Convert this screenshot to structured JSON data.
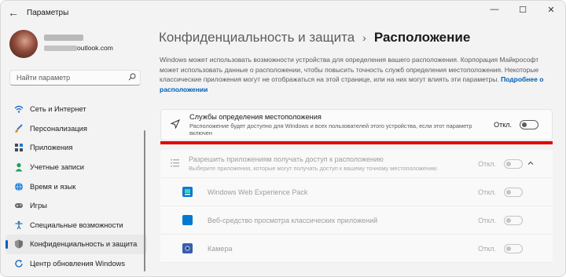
{
  "window": {
    "title": "Параметры",
    "back_icon": "back-arrow-icon",
    "controls": {
      "minimize": "—",
      "maximize": "☐",
      "close": "✕"
    }
  },
  "user": {
    "email_suffix": "outlook.com"
  },
  "search": {
    "placeholder": "Найти параметр",
    "icon": "search-icon"
  },
  "sidebar": {
    "items": [
      {
        "label": "Сеть и Интернет",
        "icon": "wifi-icon",
        "color": "#1a6fc4"
      },
      {
        "label": "Персонализация",
        "icon": "brush-icon",
        "color": "#e08a1e"
      },
      {
        "label": "Приложения",
        "icon": "apps-icon",
        "color": "#3f4a59"
      },
      {
        "label": "Учетные записи",
        "icon": "person-icon",
        "color": "#1f9e58"
      },
      {
        "label": "Время и язык",
        "icon": "globe-icon",
        "color": "#1a7bd4"
      },
      {
        "label": "Игры",
        "icon": "gamepad-icon",
        "color": "#6b6b6b"
      },
      {
        "label": "Специальные возможности",
        "icon": "accessibility-icon",
        "color": "#2a6fb5"
      },
      {
        "label": "Конфиденциальность и защита",
        "icon": "shield-icon",
        "color": "#707070",
        "active": true
      },
      {
        "label": "Центр обновления Windows",
        "icon": "update-icon",
        "color": "#1a6fc4"
      }
    ]
  },
  "breadcrumb": {
    "parent": "Конфиденциальность и защита",
    "separator": "›",
    "current": "Расположение"
  },
  "description": {
    "text": "Windows может использовать возможности устройства для определения вашего расположения. Корпорация Майкрософт может использовать данные о расположении, чтобы повысить точность служб определения местоположения. Некоторые классические приложения могут не отображаться на этой странице, или на них могут влиять эти параметры. ",
    "link": "Подробнее о расположении"
  },
  "location_services": {
    "title": "Службы определения местоположения",
    "subtitle": "Расположение будет доступно для Windows и всех пользователей этого устройства, если этот параметр включен",
    "state_label": "Откл.",
    "icon": "location-arrow-icon",
    "accent": "#e20000"
  },
  "app_access": {
    "title": "Разрешить приложениям получать доступ к расположению",
    "subtitle": "Выберите приложения, которые могут получать доступ к вашему точному местоположению",
    "state_label": "Откл.",
    "icon": "list-icon",
    "apps": [
      {
        "name": "Windows Web Experience Pack",
        "state_label": "Откл.",
        "icon": "web-experience-icon",
        "color": "#0a7bd0"
      },
      {
        "name": "Веб-средство просмотра классических приложений",
        "state_label": "Откл.",
        "icon": "web-viewer-icon",
        "color": "#0078d4"
      },
      {
        "name": "Камера",
        "state_label": "Откл.",
        "icon": "camera-icon",
        "color": "#3a5fa8"
      }
    ]
  }
}
